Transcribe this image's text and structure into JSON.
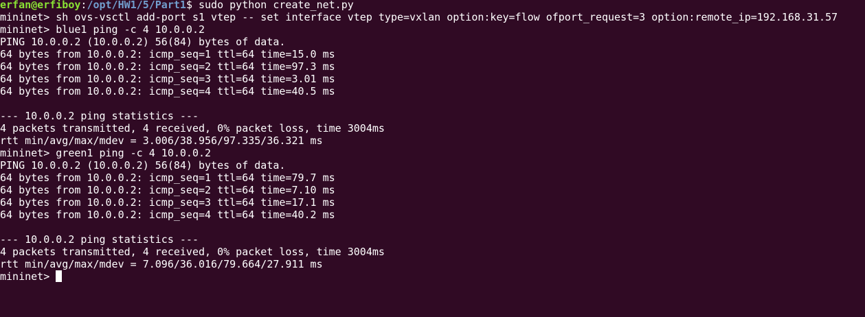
{
  "theme": {
    "background": "#300a24",
    "foreground": "#ffffff",
    "prompt_user_color": "#8ae234",
    "prompt_path_color": "#729fcf"
  },
  "prompt": {
    "user_host": "erfan@erfiboy",
    "separator": ":",
    "cwd": "/opt/HW1/5/Part1",
    "symbol": "$ ",
    "command": "sudo python create_net.py"
  },
  "lines": [
    "mininet> sh ovs-vsctl add-port s1 vtep -- set interface vtep type=vxlan option:key=flow ofport_request=3 option:remote_ip=192.168.31.57",
    "mininet> blue1 ping -c 4 10.0.0.2",
    "PING 10.0.0.2 (10.0.0.2) 56(84) bytes of data.",
    "64 bytes from 10.0.0.2: icmp_seq=1 ttl=64 time=15.0 ms",
    "64 bytes from 10.0.0.2: icmp_seq=2 ttl=64 time=97.3 ms",
    "64 bytes from 10.0.0.2: icmp_seq=3 ttl=64 time=3.01 ms",
    "64 bytes from 10.0.0.2: icmp_seq=4 ttl=64 time=40.5 ms",
    "",
    "--- 10.0.0.2 ping statistics ---",
    "4 packets transmitted, 4 received, 0% packet loss, time 3004ms",
    "rtt min/avg/max/mdev = 3.006/38.956/97.335/36.321 ms",
    "mininet> green1 ping -c 4 10.0.0.2",
    "PING 10.0.0.2 (10.0.0.2) 56(84) bytes of data.",
    "64 bytes from 10.0.0.2: icmp_seq=1 ttl=64 time=79.7 ms",
    "64 bytes from 10.0.0.2: icmp_seq=2 ttl=64 time=7.10 ms",
    "64 bytes from 10.0.0.2: icmp_seq=3 ttl=64 time=17.1 ms",
    "64 bytes from 10.0.0.2: icmp_seq=4 ttl=64 time=40.2 ms",
    "",
    "--- 10.0.0.2 ping statistics ---",
    "4 packets transmitted, 4 received, 0% packet loss, time 3004ms",
    "rtt min/avg/max/mdev = 7.096/36.016/79.664/27.911 ms"
  ],
  "current_prompt": "mininet> "
}
